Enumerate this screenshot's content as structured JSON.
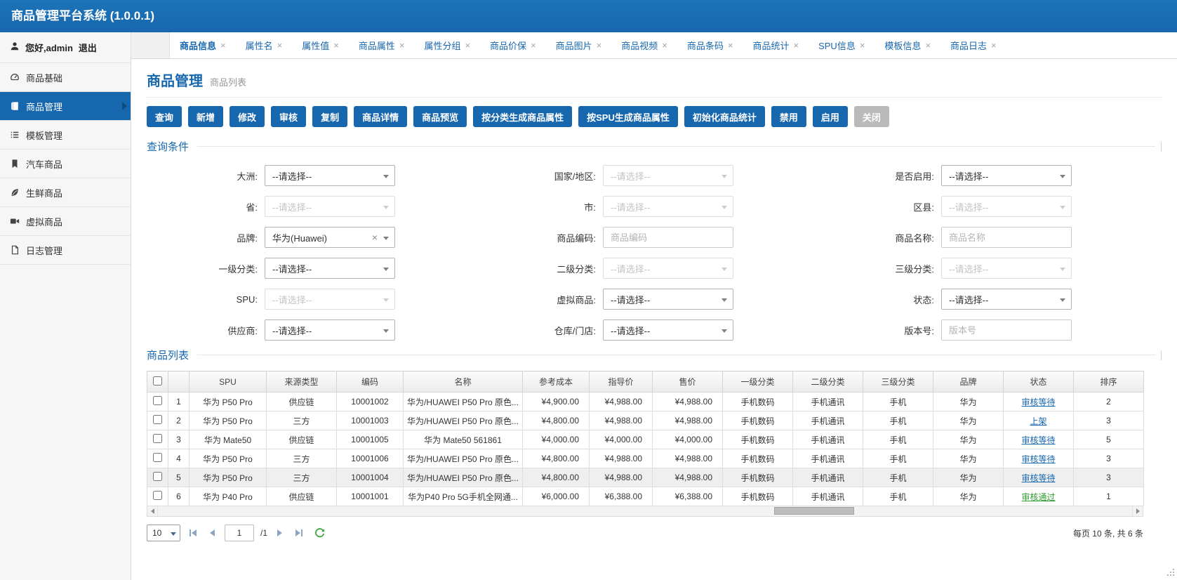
{
  "app": {
    "title": "商品管理平台系统 (1.0.0.1)"
  },
  "colors": {
    "primary": "#1767ae",
    "green": "#2e9d2e",
    "disabled_button": "#bababa"
  },
  "icons": {
    "close": "×",
    "clear": "×"
  },
  "sidebar": {
    "greeting": "您好,admin",
    "logout": "退出",
    "items": [
      {
        "label": "商品基础"
      },
      {
        "label": "商品管理"
      },
      {
        "label": "模板管理"
      },
      {
        "label": "汽车商品"
      },
      {
        "label": "生鲜商品"
      },
      {
        "label": "虚拟商品"
      },
      {
        "label": "日志管理"
      }
    ]
  },
  "tabs": [
    {
      "label": "商品信息"
    },
    {
      "label": "属性名"
    },
    {
      "label": "属性值"
    },
    {
      "label": "商品属性"
    },
    {
      "label": "属性分组"
    },
    {
      "label": "商品价保"
    },
    {
      "label": "商品图片"
    },
    {
      "label": "商品视频"
    },
    {
      "label": "商品条码"
    },
    {
      "label": "商品统计"
    },
    {
      "label": "SPU信息"
    },
    {
      "label": "模板信息"
    },
    {
      "label": "商品日志"
    }
  ],
  "page": {
    "title": "商品管理",
    "subtitle": "商品列表"
  },
  "toolbar": [
    "查询",
    "新增",
    "修改",
    "审核",
    "复制",
    "商品详情",
    "商品预览",
    "按分类生成商品属性",
    "按SPU生成商品属性",
    "初始化商品统计",
    "禁用",
    "启用",
    "关闭"
  ],
  "query": {
    "section_title": "查询条件",
    "fields": [
      {
        "label": "大洲:",
        "text": "--请选择--"
      },
      {
        "label": "国家/地区:",
        "text": "--请选择--"
      },
      {
        "label": "是否启用:",
        "text": "--请选择--"
      },
      {
        "label": "省:",
        "text": "--请选择--"
      },
      {
        "label": "市:",
        "text": "--请选择--"
      },
      {
        "label": "区县:",
        "text": "--请选择--"
      },
      {
        "label": "品牌:",
        "value": "华为(Huawei)"
      },
      {
        "label": "商品编码:",
        "placeholder": "商品编码"
      },
      {
        "label": "商品名称:",
        "placeholder": "商品名称"
      },
      {
        "label": "一级分类:",
        "text": "--请选择--"
      },
      {
        "label": "二级分类:",
        "text": "--请选择--"
      },
      {
        "label": "三级分类:",
        "text": "--请选择--"
      },
      {
        "label": "SPU:",
        "text": "--请选择--"
      },
      {
        "label": "虚拟商品:",
        "text": "--请选择--"
      },
      {
        "label": "状态:",
        "text": "--请选择--"
      },
      {
        "label": "供应商:",
        "text": "--请选择--"
      },
      {
        "label": "仓库/门店:",
        "text": "--请选择--"
      },
      {
        "label": "版本号:",
        "placeholder": "版本号"
      }
    ]
  },
  "table": {
    "section_title": "商品列表",
    "columns": [
      "SPU",
      "来源类型",
      "编码",
      "名称",
      "参考成本",
      "指导价",
      "售价",
      "一级分类",
      "二级分类",
      "三级分类",
      "品牌",
      "状态",
      "排序"
    ],
    "rows": [
      {
        "num": "1",
        "spu": "华为 P50 Pro",
        "source": "供应链",
        "code": "10001002",
        "name": "华为/HUAWEI P50 Pro 原色...",
        "cost": "¥4,900.00",
        "guide": "¥4,988.00",
        "price": "¥4,988.00",
        "cat1": "手机数码",
        "cat2": "手机通讯",
        "cat3": "手机",
        "brand": "华为",
        "status": "审核等待",
        "status_color": "#1767ae",
        "sort": "2"
      },
      {
        "num": "2",
        "spu": "华为 P50 Pro",
        "source": "三方",
        "code": "10001003",
        "name": "华为/HUAWEI P50 Pro 原色...",
        "cost": "¥4,800.00",
        "guide": "¥4,988.00",
        "price": "¥4,988.00",
        "cat1": "手机数码",
        "cat2": "手机通讯",
        "cat3": "手机",
        "brand": "华为",
        "status": "上架",
        "status_color": "#1767ae",
        "sort": "3"
      },
      {
        "num": "3",
        "spu": "华为 Mate50",
        "source": "供应链",
        "code": "10001005",
        "name": "华为 Mate50 561861",
        "cost": "¥4,000.00",
        "guide": "¥4,000.00",
        "price": "¥4,000.00",
        "cat1": "手机数码",
        "cat2": "手机通讯",
        "cat3": "手机",
        "brand": "华为",
        "status": "审核等待",
        "status_color": "#1767ae",
        "sort": "5"
      },
      {
        "num": "4",
        "spu": "华为 P50 Pro",
        "source": "三方",
        "code": "10001006",
        "name": "华为/HUAWEI P50 Pro 原色...",
        "cost": "¥4,800.00",
        "guide": "¥4,988.00",
        "price": "¥4,988.00",
        "cat1": "手机数码",
        "cat2": "手机通讯",
        "cat3": "手机",
        "brand": "华为",
        "status": "审核等待",
        "status_color": "#1767ae",
        "sort": "3"
      },
      {
        "num": "5",
        "spu": "华为 P50 Pro",
        "source": "三方",
        "code": "10001004",
        "name": "华为/HUAWEI P50 Pro 原色...",
        "cost": "¥4,800.00",
        "guide": "¥4,988.00",
        "price": "¥4,988.00",
        "cat1": "手机数码",
        "cat2": "手机通讯",
        "cat3": "手机",
        "brand": "华为",
        "status": "审核等待",
        "status_color": "#1767ae",
        "sort": "3"
      },
      {
        "num": "6",
        "spu": "华为 P40 Pro",
        "source": "供应链",
        "code": "10001001",
        "name": "华为P40 Pro 5G手机全网通...",
        "cost": "¥6,000.00",
        "guide": "¥6,388.00",
        "price": "¥6,388.00",
        "cat1": "手机数码",
        "cat2": "手机通讯",
        "cat3": "手机",
        "brand": "华为",
        "status": "审核通过",
        "status_color": "#2e9d2e",
        "sort": "1"
      }
    ]
  },
  "pager": {
    "page_size": "10",
    "page": "1",
    "total_label": "/1",
    "summary": "每页 10 条, 共 6 条"
  }
}
